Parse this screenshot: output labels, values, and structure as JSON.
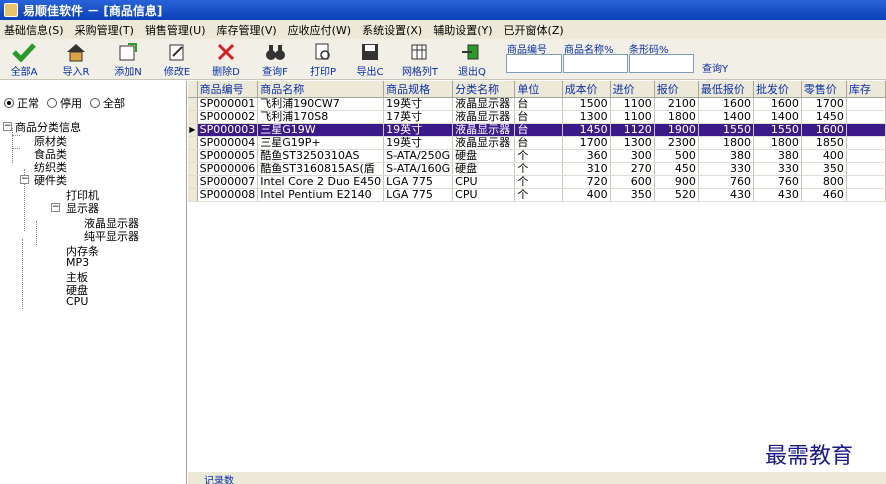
{
  "window": {
    "title": "易顺佳软件 － [商品信息]"
  },
  "menu": [
    "基础信息(S)",
    "采购管理(T)",
    "销售管理(U)",
    "库存管理(V)",
    "应收应付(W)",
    "系统设置(X)",
    "辅助设置(Y)",
    "已开窗体(Z)"
  ],
  "toolbar": {
    "all": "全部A",
    "import": "导入R",
    "add": "添加N",
    "edit": "修改E",
    "delete": "删除D",
    "search": "查询F",
    "print": "打印P",
    "export": "导出C",
    "grid_cols": "网格列T",
    "exit": "退出Q"
  },
  "search": {
    "code_label": "商品编号",
    "name_label": "商品名称%",
    "barcode_label": "条形码%",
    "code_value": "",
    "name_value": "",
    "barcode_value": "",
    "query_label": "查询Y"
  },
  "filter": {
    "normal": "正常",
    "disabled": "停用",
    "all": "全部",
    "selected": "normal"
  },
  "tree": {
    "root": "商品分类信息",
    "items": [
      "原材类",
      "食品类",
      "纺织类",
      "硬件类",
      "打印机",
      "显示器",
      "液晶显示器",
      "纯平显示器",
      "内存条",
      "MP3",
      "主板",
      "硬盘",
      "CPU"
    ]
  },
  "table": {
    "columns": [
      "商品编号",
      "商品名称",
      "商品规格",
      "分类名称",
      "单位",
      "成本价",
      "进价",
      "报价",
      "最低报价",
      "批发价",
      "零售价",
      "库存"
    ],
    "rows": [
      [
        "SP000001",
        "飞利浦190CW7",
        "19英寸",
        "液晶显示器",
        "台",
        "1500",
        "1100",
        "2100",
        "1600",
        "1600",
        "1700"
      ],
      [
        "SP000002",
        "飞利浦170S8",
        "17英寸",
        "液晶显示器",
        "台",
        "1300",
        "1100",
        "1800",
        "1400",
        "1400",
        "1450"
      ],
      [
        "SP000003",
        "三星G19W",
        "19英寸",
        "液晶显示器",
        "台",
        "1450",
        "1120",
        "1900",
        "1550",
        "1550",
        "1600"
      ],
      [
        "SP000004",
        "三星G19P+",
        "19英寸",
        "液晶显示器",
        "台",
        "1700",
        "1300",
        "2300",
        "1800",
        "1800",
        "1850"
      ],
      [
        "SP000005",
        "酷鱼ST3250310AS",
        "S-ATA/250G",
        "硬盘",
        "个",
        "360",
        "300",
        "500",
        "380",
        "380",
        "400"
      ],
      [
        "SP000006",
        "酷鱼ST3160815AS(盾",
        "S-ATA/160G",
        "硬盘",
        "个",
        "310",
        "270",
        "450",
        "330",
        "330",
        "350"
      ],
      [
        "SP000007",
        "Intel Core 2 Duo E450",
        "LGA 775",
        "CPU",
        "个",
        "720",
        "600",
        "900",
        "760",
        "760",
        "800"
      ],
      [
        "SP000008",
        "Intel Pentium E2140",
        "LGA 775",
        "CPU",
        "个",
        "400",
        "350",
        "520",
        "430",
        "430",
        "460"
      ]
    ],
    "selected_index": 2,
    "footer": "记录数"
  },
  "watermark": "最需教育"
}
